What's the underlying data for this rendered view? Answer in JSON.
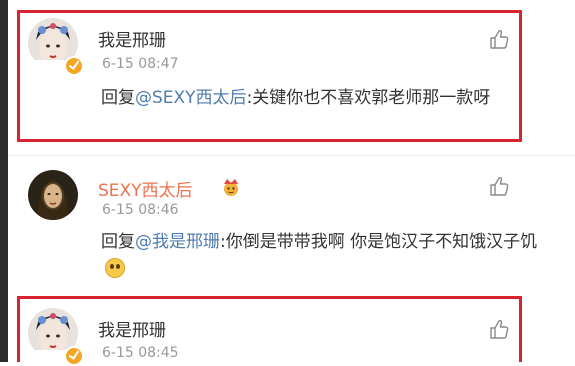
{
  "comments": [
    {
      "name": "我是邢珊",
      "time": "6-15 08:47",
      "reply_prefix": "回复",
      "mention": "@SEXY西太后",
      "text": ":关键你也不喜欢郭老师那一款呀",
      "verified": true
    },
    {
      "name": "SEXY西太后",
      "time": "6-15 08:46",
      "reply_prefix": "回复",
      "mention": "@我是邢珊",
      "text": ":你倒是带带我啊 你是饱汉子不知饿汉子饥",
      "badge_icon": "crown-face-icon",
      "emoji_icon": "pleading-face-icon",
      "verified": false
    },
    {
      "name": "我是邢珊",
      "time": "6-15 08:45",
      "verified": true
    }
  ],
  "icons": {
    "like": "thumbs-up-icon",
    "verified": "verified-badge-icon"
  },
  "colors": {
    "highlight_border": "#d9232f",
    "mention": "#507daf",
    "orange_name": "#eb7350",
    "verified_badge": "#f6a623"
  }
}
